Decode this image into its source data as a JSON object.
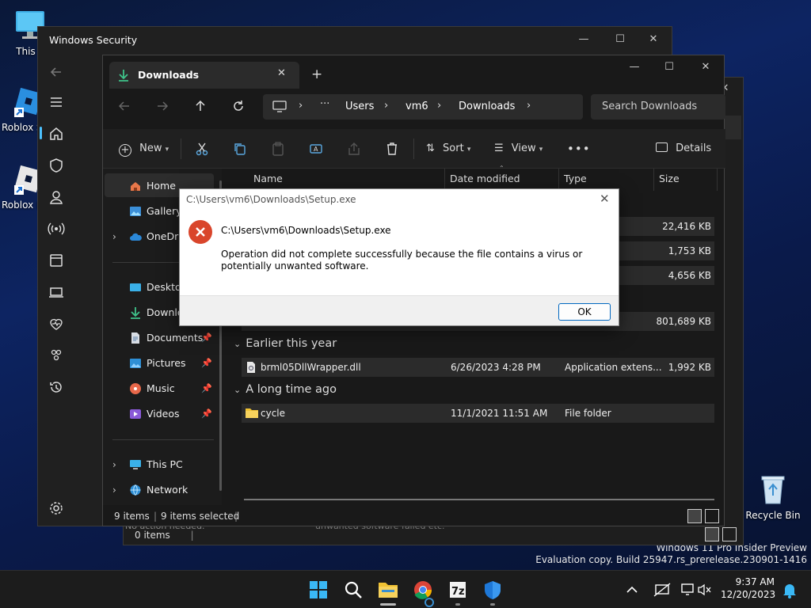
{
  "desktop": {
    "icons": [
      {
        "label": "This P",
        "name": "this-pc-desktop-icon"
      },
      {
        "label": "Roblox S",
        "name": "roblox-studio-desktop-icon"
      },
      {
        "label": "Roblox P",
        "name": "roblox-player-desktop-icon"
      },
      {
        "label": "Recycle Bin",
        "name": "recycle-bin-desktop-icon"
      }
    ],
    "watermark": {
      "line1": "Windows 11 Pro Insider Preview",
      "line2": "Evaluation copy. Build 25947.rs_prerelease.230901-1416"
    }
  },
  "windows_security": {
    "title": "Windows Security",
    "status_items": "0 items",
    "hidden_text_1": "No action needed.",
    "hidden_text_2": "unwanted software failed etc."
  },
  "explorer": {
    "tab_title": "Downloads",
    "breadcrumb": [
      "Users",
      "vm6",
      "Downloads"
    ],
    "search_placeholder": "Search Downloads",
    "toolbar": {
      "new": "New",
      "sort": "Sort",
      "view": "View",
      "details": "Details"
    },
    "sidebar": [
      {
        "label": "Home",
        "pinned": false
      },
      {
        "label": "Gallery",
        "pinned": false
      },
      {
        "label": "OneDriv",
        "pinned": false
      },
      {
        "label": "Desktop",
        "pinned": false
      },
      {
        "label": "Downlo",
        "pinned": false
      },
      {
        "label": "Documents",
        "pinned": true
      },
      {
        "label": "Pictures",
        "pinned": true
      },
      {
        "label": "Music",
        "pinned": true
      },
      {
        "label": "Videos",
        "pinned": true
      },
      {
        "label": "This PC",
        "pinned": false
      },
      {
        "label": "Network",
        "pinned": false
      }
    ],
    "columns": {
      "name": "Name",
      "date": "Date modified",
      "type": "Type",
      "size": "Size"
    },
    "hidden_rows": [
      {
        "size": "22,416 KB"
      },
      {
        "size": "1,753 KB"
      },
      {
        "size": "4,656 KB"
      },
      {
        "size": "801,689 KB"
      }
    ],
    "groups": [
      {
        "label": "Earlier this year",
        "files": [
          {
            "name": "brml05DllWrapper.dll",
            "date": "6/26/2023 4:28 PM",
            "type": "Application extens...",
            "size": "1,992 KB"
          }
        ]
      },
      {
        "label": "A long time ago",
        "files": [
          {
            "name": "cycle",
            "date": "11/1/2021 11:51 AM",
            "type": "File folder",
            "size": ""
          }
        ]
      }
    ],
    "status": {
      "items": "9 items",
      "selected": "9 items selected"
    }
  },
  "dialog": {
    "title": "C:\\Users\\vm6\\Downloads\\Setup.exe",
    "path": "C:\\Users\\vm6\\Downloads\\Setup.exe",
    "message": "Operation did not complete successfully because the file contains a virus or potentially unwanted software.",
    "ok": "OK"
  },
  "taskbar": {
    "time": "9:37 AM",
    "date": "12/20/2023"
  },
  "colors": {
    "error_icon": "#d9452b",
    "accent": "#0067c0",
    "folder": "#f0c233"
  }
}
